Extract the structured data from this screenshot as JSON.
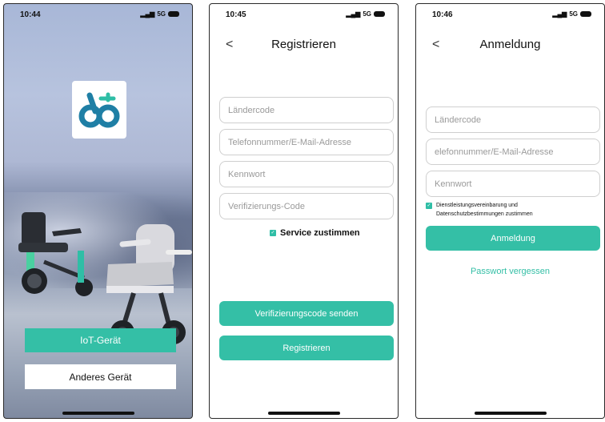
{
  "screen_iot": {
    "time": "10:44",
    "signal": "5G",
    "iot_button": "IoT-Gerät",
    "other_button": "Anderes Gerät"
  },
  "screen_register": {
    "time": "10:45",
    "signal": "5G",
    "back": "<",
    "title": "Registrieren",
    "fields": {
      "country_code": "Ländercode",
      "phone_email": "Telefonnummer/E-Mail-Adresse",
      "password": "Kennwort",
      "verification_code": "Verifizierungs-Code"
    },
    "agree_label": "Service zustimmen",
    "send_code_button": "Verifizierungscode senden",
    "register_button": "Registrieren"
  },
  "screen_login": {
    "time": "10:46",
    "signal": "5G",
    "back": "<",
    "title": "Anmeldung",
    "fields": {
      "country_code": "Ländercode",
      "phone_email": "elefonnummer/E-Mail-Adresse",
      "password": "Kennwort"
    },
    "agree_label_line1": "Dienstleistungsvereinbarung und",
    "agree_label_line2": "Datenschutzbestimmungen zustimmen",
    "login_button": "Anmeldung",
    "forgot_password": "Passwort vergessen"
  },
  "colors": {
    "accent": "#34bfa6",
    "field_border": "#cfcfcf",
    "placeholder": "#9a9a9a"
  },
  "icons": [
    "signal-icon",
    "battery-icon",
    "back-chevron-icon",
    "app-logo-icon",
    "checkbox-checked-icon"
  ]
}
